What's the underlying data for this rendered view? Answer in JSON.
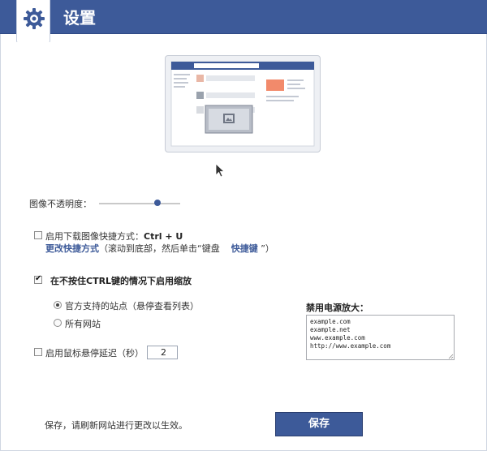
{
  "header": {
    "title": "设置",
    "icon": "gear-icon"
  },
  "opacity": {
    "label": "图像不透明度：",
    "level_fraction": 0.72
  },
  "download_shortcut": {
    "checked": false,
    "label_prefix": "启用下载图像快捷方式：",
    "shortcut": "Ctrl + U",
    "change_link": "更改快捷方式",
    "hint_before": "（滚动到底部，然后单击“键盘",
    "hint_link": "快捷键",
    "hint_after": "”）"
  },
  "zoom": {
    "checked": true,
    "label": "在不按住CTRL键的情况下启用缩放",
    "option_supported": "官方支持的站点（悬停查看列表）",
    "option_all": "所有网站",
    "selected": "option_supported"
  },
  "hover_delay": {
    "checked": false,
    "label": "启用鼠标悬停延迟（秒）",
    "value": "2"
  },
  "disabled_sites": {
    "label": "禁用电源放大：",
    "text": "example.com\nexample.net\nwww.example.com\nhttp://www.example.com"
  },
  "footer": {
    "note": "保存，请刷新网站进行更改以生效。",
    "save_label": "保存"
  },
  "colors": {
    "brand": "#3d5a99",
    "accent_orange": "#f28a6b"
  }
}
